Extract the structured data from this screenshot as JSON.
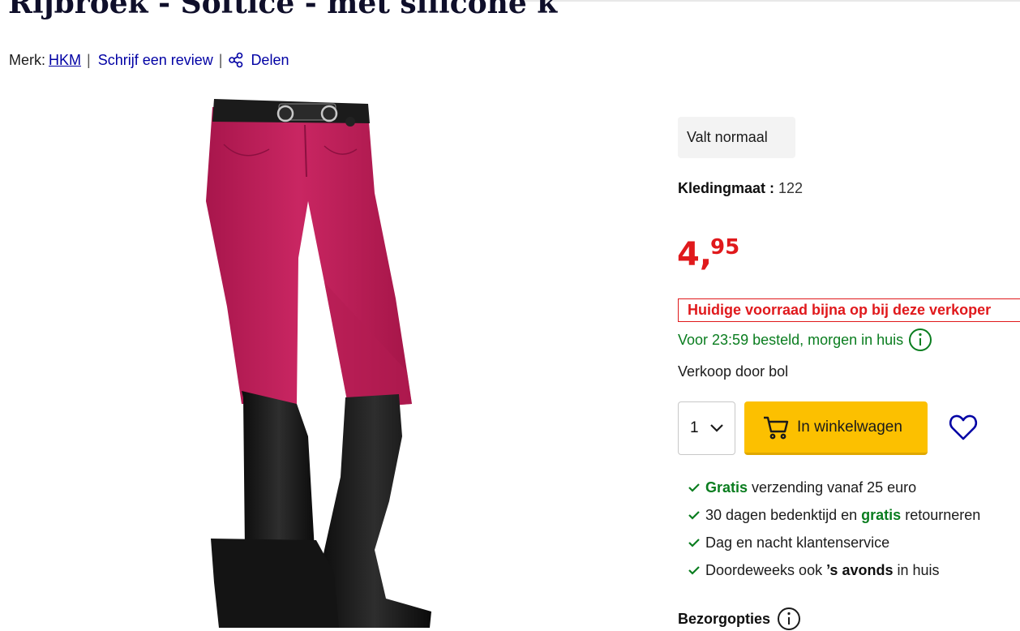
{
  "product": {
    "title": "Rijbroek - Softice - met silicone k",
    "merk_label": "Merk:",
    "brand": "HKM",
    "separator": "|",
    "review_link": "Schrijf een review",
    "share_label": "Delen"
  },
  "buybox": {
    "fit_badge": "Valt normaal",
    "size_label": "Kledingmaat :",
    "size_value": "122",
    "price_euros": "4,",
    "price_cents": "95",
    "stock_warning": "Huidige voorraad bijna op bij deze verkoper",
    "delivery": "Voor 23:59 besteld, morgen in huis",
    "seller": "Verkoop door bol",
    "quantity": "1",
    "cart_button": "In winkelwagen",
    "bezorgopties": "Bezorgopties"
  },
  "usps": [
    {
      "pre": "",
      "bold": "Gratis",
      "post": " verzending vanaf 25 euro"
    },
    {
      "pre": "30 dagen bedenktijd en ",
      "bold": "gratis",
      "post": " retourneren"
    },
    {
      "pre": "Dag en nacht klantenservice",
      "bold": "",
      "post": ""
    },
    {
      "pre": "Doordeweeks ook ",
      "bold": "’s avonds",
      "post": " in huis"
    }
  ],
  "colors": {
    "price_red": "#e0191c",
    "delivery_green": "#0a7d1f",
    "link_blue": "#0000a4",
    "cart_yellow": "#fcc000",
    "garment_pink": "#c21f5c"
  },
  "icons": [
    "share-icon",
    "info-icon",
    "chevron-down-icon",
    "cart-icon",
    "heart-icon",
    "check-icon"
  ]
}
